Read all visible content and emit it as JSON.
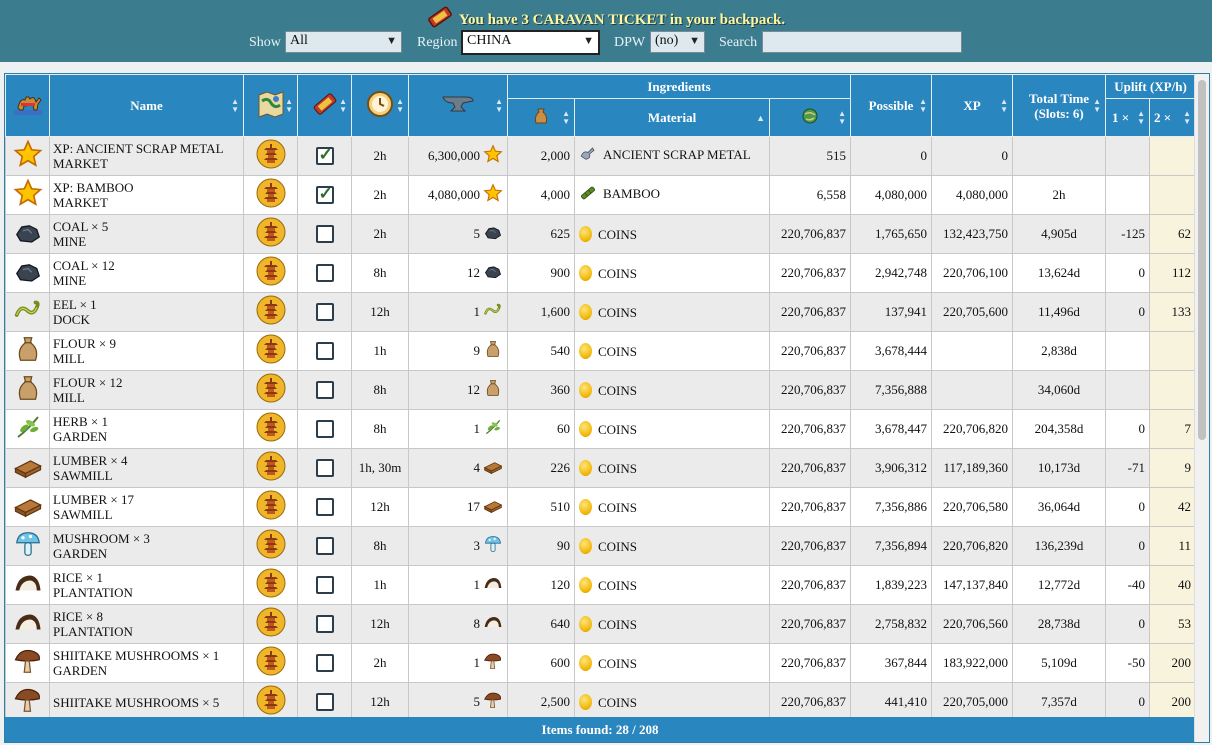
{
  "banner": {
    "message": "You have 3 CARAVAN TICKET in your backpack."
  },
  "filters": {
    "show_label": "Show",
    "show_value": "All",
    "region_label": "Region",
    "region_value": "CHINA",
    "dpw_label": "DPW",
    "dpw_value": "(no)",
    "search_label": "Search",
    "search_value": ""
  },
  "table": {
    "headers": {
      "name": "Name",
      "ingredients": "Ingredients",
      "material": "Material",
      "possible": "Possible",
      "xp": "XP",
      "total_time": "Total Time",
      "total_time_sub": "(Slots: 6)",
      "uplift": "Uplift (XP/h)",
      "uplift_1": "1 ×",
      "uplift_2": "2 ×"
    },
    "rows": [
      {
        "icon": "star",
        "n1": "XP: ANCIENT SCRAP METAL",
        "n2": "MARKET",
        "checked": true,
        "time": "2h",
        "qty": "6,300,000",
        "qicon": "star",
        "ing": "2,000",
        "micon": "scrap",
        "mat": "ANCIENT SCRAP METAL",
        "stock": "515",
        "possible": "0",
        "xp": "0",
        "total": "",
        "u1": "",
        "u2": ""
      },
      {
        "icon": "star",
        "n1": "XP: BAMBOO",
        "n2": "MARKET",
        "checked": true,
        "time": "2h",
        "qty": "4,080,000",
        "qicon": "star",
        "ing": "4,000",
        "micon": "bamboo",
        "mat": "BAMBOO",
        "stock": "6,558",
        "possible": "4,080,000",
        "xp": "4,080,000",
        "total": "2h",
        "u1": "",
        "u2": ""
      },
      {
        "icon": "coal",
        "n1": "COAL × 5",
        "n2": "MINE",
        "checked": false,
        "time": "2h",
        "qty": "5",
        "qicon": "coal",
        "ing": "625",
        "micon": "coin",
        "mat": "COINS",
        "stock": "220,706,837",
        "possible": "1,765,650",
        "xp": "132,423,750",
        "total": "4,905d",
        "u1": "-125",
        "u2": "62"
      },
      {
        "icon": "coal",
        "n1": "COAL × 12",
        "n2": "MINE",
        "checked": false,
        "time": "8h",
        "qty": "12",
        "qicon": "coal",
        "ing": "900",
        "micon": "coin",
        "mat": "COINS",
        "stock": "220,706,837",
        "possible": "2,942,748",
        "xp": "220,706,100",
        "total": "13,624d",
        "u1": "0",
        "u2": "112"
      },
      {
        "icon": "eel",
        "n1": "EEL × 1",
        "n2": "DOCK",
        "checked": false,
        "time": "12h",
        "qty": "1",
        "qicon": "eel",
        "ing": "1,600",
        "micon": "coin",
        "mat": "COINS",
        "stock": "220,706,837",
        "possible": "137,941",
        "xp": "220,705,600",
        "total": "11,496d",
        "u1": "0",
        "u2": "133"
      },
      {
        "icon": "flour",
        "n1": "FLOUR × 9",
        "n2": "MILL",
        "checked": false,
        "time": "1h",
        "qty": "9",
        "qicon": "flour",
        "ing": "540",
        "micon": "coin",
        "mat": "COINS",
        "stock": "220,706,837",
        "possible": "3,678,444",
        "xp": "",
        "total": "2,838d",
        "u1": "",
        "u2": ""
      },
      {
        "icon": "flour",
        "n1": "FLOUR × 12",
        "n2": "MILL",
        "checked": false,
        "time": "8h",
        "qty": "12",
        "qicon": "flour",
        "ing": "360",
        "micon": "coin",
        "mat": "COINS",
        "stock": "220,706,837",
        "possible": "7,356,888",
        "xp": "",
        "total": "34,060d",
        "u1": "",
        "u2": ""
      },
      {
        "icon": "herb",
        "n1": "HERB × 1",
        "n2": "GARDEN",
        "checked": false,
        "time": "8h",
        "qty": "1",
        "qicon": "herb",
        "ing": "60",
        "micon": "coin",
        "mat": "COINS",
        "stock": "220,706,837",
        "possible": "3,678,447",
        "xp": "220,706,820",
        "total": "204,358d",
        "u1": "0",
        "u2": "7"
      },
      {
        "icon": "lumber",
        "n1": "LUMBER × 4",
        "n2": "SAWMILL",
        "checked": false,
        "time": "1h, 30m",
        "qty": "4",
        "qicon": "lumber",
        "ing": "226",
        "micon": "coin",
        "mat": "COINS",
        "stock": "220,706,837",
        "possible": "3,906,312",
        "xp": "117,189,360",
        "total": "10,173d",
        "u1": "-71",
        "u2": "9"
      },
      {
        "icon": "lumber",
        "n1": "LUMBER × 17",
        "n2": "SAWMILL",
        "checked": false,
        "time": "12h",
        "qty": "17",
        "qicon": "lumber",
        "ing": "510",
        "micon": "coin",
        "mat": "COINS",
        "stock": "220,706,837",
        "possible": "7,356,886",
        "xp": "220,706,580",
        "total": "36,064d",
        "u1": "0",
        "u2": "42"
      },
      {
        "icon": "mushroom",
        "n1": "MUSHROOM × 3",
        "n2": "GARDEN",
        "checked": false,
        "time": "8h",
        "qty": "3",
        "qicon": "mushroom",
        "ing": "90",
        "micon": "coin",
        "mat": "COINS",
        "stock": "220,706,837",
        "possible": "7,356,894",
        "xp": "220,706,820",
        "total": "136,239d",
        "u1": "0",
        "u2": "11"
      },
      {
        "icon": "rice",
        "n1": "RICE × 1",
        "n2": "PLANTATION",
        "checked": false,
        "time": "1h",
        "qty": "1",
        "qicon": "rice",
        "ing": "120",
        "micon": "coin",
        "mat": "COINS",
        "stock": "220,706,837",
        "possible": "1,839,223",
        "xp": "147,137,840",
        "total": "12,772d",
        "u1": "-40",
        "u2": "40"
      },
      {
        "icon": "rice",
        "n1": "RICE × 8",
        "n2": "PLANTATION",
        "checked": false,
        "time": "12h",
        "qty": "8",
        "qicon": "rice",
        "ing": "640",
        "micon": "coin",
        "mat": "COINS",
        "stock": "220,706,837",
        "possible": "2,758,832",
        "xp": "220,706,560",
        "total": "28,738d",
        "u1": "0",
        "u2": "53"
      },
      {
        "icon": "shiitake",
        "n1": "SHIITAKE MUSHROOMS × 1",
        "n2": "GARDEN",
        "checked": false,
        "time": "2h",
        "qty": "1",
        "qicon": "shiitake",
        "ing": "600",
        "micon": "coin",
        "mat": "COINS",
        "stock": "220,706,837",
        "possible": "367,844",
        "xp": "183,922,000",
        "total": "5,109d",
        "u1": "-50",
        "u2": "200"
      },
      {
        "icon": "shiitake",
        "n1": "SHIITAKE MUSHROOMS × 5",
        "n2": "",
        "checked": false,
        "time": "12h",
        "qty": "5",
        "qicon": "shiitake",
        "ing": "2,500",
        "micon": "coin",
        "mat": "COINS",
        "stock": "220,706,837",
        "possible": "441,410",
        "xp": "220,705,000",
        "total": "7,357d",
        "u1": "0",
        "u2": "200"
      }
    ]
  },
  "footer": {
    "items_found": "Items found: 28 / 208"
  }
}
